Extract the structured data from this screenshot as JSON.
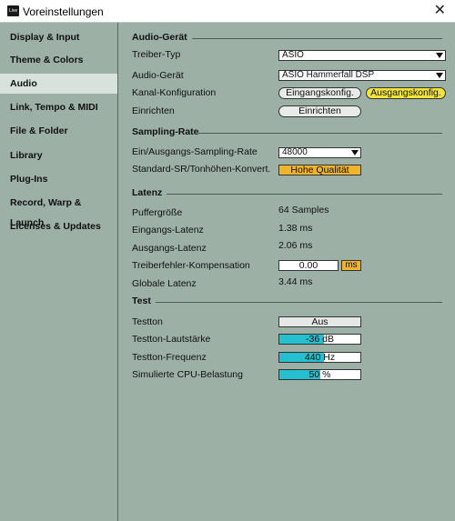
{
  "window": {
    "title": "Voreinstellungen",
    "icon_text": "Live"
  },
  "sidebar": {
    "items": [
      {
        "label": "Display & Input"
      },
      {
        "label": "Theme & Colors"
      },
      {
        "label": "Audio",
        "active": true
      },
      {
        "label": "Link, Tempo & MIDI"
      },
      {
        "label": "File & Folder"
      },
      {
        "label": "Library"
      },
      {
        "label": "Plug-Ins"
      },
      {
        "label": "Record, Warp & Launch"
      },
      {
        "label": "Licenses & Updates"
      }
    ]
  },
  "audio_device": {
    "section": "Audio-Gerät",
    "driver_type_label": "Treiber-Typ",
    "driver_type_value": "ASIO",
    "device_label": "Audio-Gerät",
    "device_value": "ASIO Hammerfall DSP",
    "channel_config_label": "Kanal-Konfiguration",
    "input_config_button": "Eingangskonfig.",
    "output_config_button": "Ausgangskonfig.",
    "setup_label": "Einrichten",
    "setup_button": "Einrichten"
  },
  "sample_rate": {
    "section": "Sampling-Rate",
    "io_rate_label": "Ein/Ausgangs-Sampling-Rate",
    "io_rate_value": "48000",
    "default_sr_label": "Standard-SR/Tonhöhen-Konvert.",
    "default_sr_value": "Hohe Qualität"
  },
  "latency": {
    "section": "Latenz",
    "buffer_label": "Puffergröße",
    "buffer_value": "64 Samples",
    "input_latency_label": "Eingangs-Latenz",
    "input_latency_value": "1.38 ms",
    "output_latency_label": "Ausgangs-Latenz",
    "output_latency_value": "2.06 ms",
    "driver_comp_label": "Treiberfehler-Kompensation",
    "driver_comp_value": "0.00",
    "driver_comp_unit": "ms",
    "overall_label": "Globale Latenz",
    "overall_value": "3.44 ms"
  },
  "test": {
    "section": "Test",
    "tone_label": "Testton",
    "tone_value": "Aus",
    "volume_label": "Testton-Lautstärke",
    "volume_text": "-36 dB",
    "volume_level": 0.55,
    "frequency_label": "Testton-Frequenz",
    "frequency_text": "440 Hz",
    "frequency_level": 0.55,
    "cpu_label": "Simulierte CPU-Belastung",
    "cpu_text": "50 %",
    "cpu_level": 0.5
  },
  "colors": {
    "background": "#9cb0a6",
    "active_item": "#d8e2dd",
    "toggle_on": "#f2e43a",
    "orange": "#f0b42a",
    "slider_fill": "#26bfd0"
  }
}
